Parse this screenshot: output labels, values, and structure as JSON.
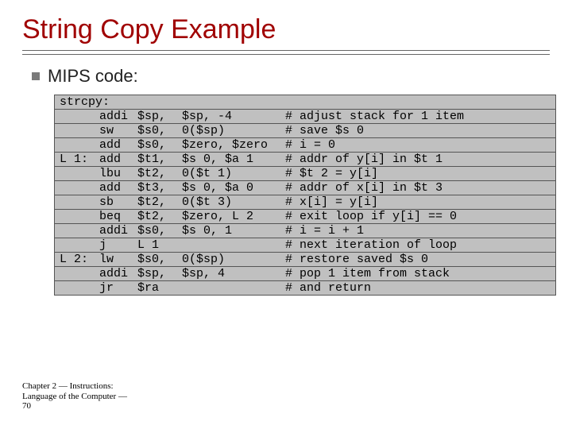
{
  "title": "String Copy Example",
  "subtitle": "MIPS code:",
  "code": {
    "header": "strcpy:",
    "rows": [
      {
        "label": "",
        "op": "addi",
        "reg": "$sp,",
        "args": "$sp, -4",
        "comment": "# adjust stack for 1 item"
      },
      {
        "label": "",
        "op": "sw",
        "reg": "$s0,",
        "args": "0($sp)",
        "comment": "# save $s 0"
      },
      {
        "label": "",
        "op": "add",
        "reg": "$s0,",
        "args": "$zero, $zero",
        "comment": "# i = 0"
      },
      {
        "label": "L 1:",
        "op": "add",
        "reg": "$t1,",
        "args": "$s 0, $a 1",
        "comment": "# addr of y[i] in $t 1"
      },
      {
        "label": "",
        "op": "lbu",
        "reg": "$t2,",
        "args": "0($t 1)",
        "comment": "# $t 2 = y[i]"
      },
      {
        "label": "",
        "op": "add",
        "reg": "$t3,",
        "args": "$s 0, $a 0",
        "comment": "# addr of x[i] in $t 3"
      },
      {
        "label": "",
        "op": "sb",
        "reg": "$t2,",
        "args": "0($t 3)",
        "comment": "# x[i] = y[i]"
      },
      {
        "label": "",
        "op": "beq",
        "reg": "$t2,",
        "args": "$zero, L 2",
        "comment": "# exit loop if y[i] == 0"
      },
      {
        "label": "",
        "op": "addi",
        "reg": "$s0,",
        "args": "$s 0, 1",
        "comment": "# i = i + 1"
      },
      {
        "label": "",
        "op": "j",
        "reg": "L 1",
        "args": "",
        "comment": "# next iteration of loop"
      },
      {
        "label": "L 2:",
        "op": "lw",
        "reg": "$s0,",
        "args": "0($sp)",
        "comment": "# restore saved $s 0"
      },
      {
        "label": "",
        "op": "addi",
        "reg": "$sp,",
        "args": "$sp, 4",
        "comment": "# pop 1 item from stack"
      },
      {
        "label": "",
        "op": "jr",
        "reg": "$ra",
        "args": "",
        "comment": "# and return"
      }
    ]
  },
  "footer": {
    "l1": "Chapter 2 — Instructions:",
    "l2": "Language of the Computer —",
    "l3": "70"
  }
}
